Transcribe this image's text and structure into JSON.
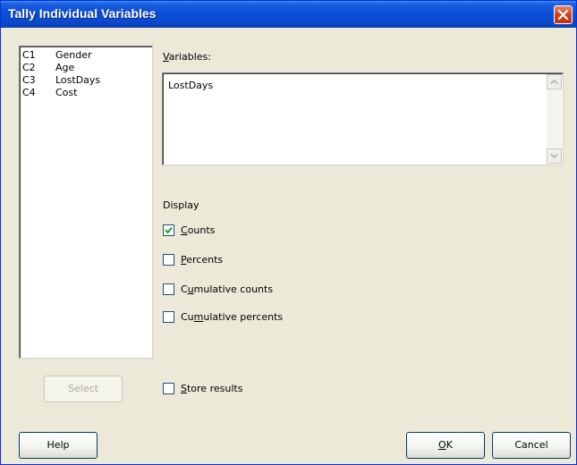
{
  "window": {
    "title": "Tally Individual Variables"
  },
  "columns_list": {
    "items": [
      {
        "col": "C1",
        "name": "Gender"
      },
      {
        "col": "C2",
        "name": "Age"
      },
      {
        "col": "C3",
        "name": "LostDays"
      },
      {
        "col": "C4",
        "name": "Cost"
      }
    ]
  },
  "variables": {
    "label_mnemonic": "V",
    "label_rest": "ariables:",
    "value": "LostDays"
  },
  "display": {
    "heading": "Display",
    "options": [
      {
        "pre": "",
        "mn": "C",
        "post": "ounts",
        "checked": true
      },
      {
        "pre": "",
        "mn": "P",
        "post": "ercents",
        "checked": false
      },
      {
        "pre": "C",
        "mn": "u",
        "post": "mulative counts",
        "checked": false
      },
      {
        "pre": "Cu",
        "mn": "m",
        "post": "ulative percents",
        "checked": false
      }
    ]
  },
  "store_results": {
    "pre": "",
    "mn": "S",
    "post": "tore results",
    "checked": false
  },
  "buttons": {
    "select": "Select",
    "help": "Help",
    "ok_mnemonic": "O",
    "ok_rest": "K",
    "cancel": "Cancel"
  },
  "colors": {
    "title_bar": "#0a4ed6",
    "close_button": "#d2401c",
    "dialog_bg": "#ece9d8"
  }
}
